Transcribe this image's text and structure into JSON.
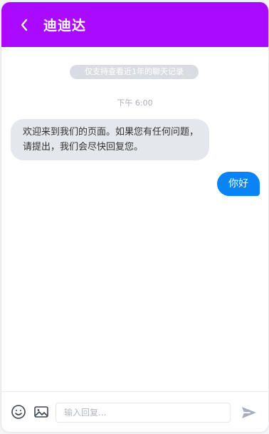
{
  "colors": {
    "header": "#aa0aff",
    "sent_bubble": "#0a84f5",
    "received_bubble": "#e4e7ec",
    "notice_bg": "#d9dde3"
  },
  "header": {
    "title": "迪迪达",
    "back_icon": "chevron-left-icon"
  },
  "chat": {
    "notice": "仅支持查看近1年的聊天记录",
    "time": "下午 6:00",
    "received_message": "欢迎来到我们的页面。如果您有任何问题，请提出，我们会尽快回复您。",
    "sent_message": "你好"
  },
  "footer": {
    "emoji_icon": "smile-icon",
    "image_icon": "image-icon",
    "input_placeholder": "输入回复...",
    "send_icon": "send-icon"
  }
}
